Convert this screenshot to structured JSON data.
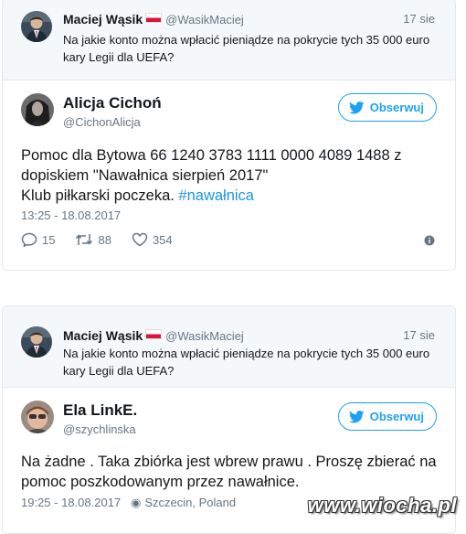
{
  "tweets": [
    {
      "reply": {
        "name": "Maciej Wąsik",
        "handle": "@WasikMaciej",
        "date": "17 sie",
        "text": "Na jakie konto można wpłacić pieniądze na pokrycie tych 35 000 euro kary Legii dla UEFA?"
      },
      "author": {
        "name": "Alicja Cichoń",
        "handle": "@CichonAlicja"
      },
      "follow_label": "Obserwuj",
      "lines": [
        "Pomoc dla Bytowa 66 1240 3783 1111 0000 4089 1488 z",
        "dopiskiem \"Nawałnica sierpień 2017\""
      ],
      "line3_text": "Klub piłkarski poczeka. ",
      "hashtag": "#nawałnica",
      "timestamp": "13:25 - 18.08.2017",
      "replies": "15",
      "retweets": "88",
      "likes": "354"
    },
    {
      "reply": {
        "name": "Maciej Wąsik",
        "handle": "@WasikMaciej",
        "date": "17 sie",
        "text": "Na jakie konto można wpłacić pieniądze na pokrycie tych 35 000 euro kary Legii dla UEFA?"
      },
      "author": {
        "name": "Ela LinkE.",
        "handle": "@szychlinska"
      },
      "follow_label": "Obserwuj",
      "lines": [
        "Na żadne . Taka zbiórka jest wbrew prawu . Proszę zbierać na",
        "pomoc poszkodowanym przez nawałnice."
      ],
      "timestamp": "19:25 - 18.08.2017",
      "location": "Szczecin, Poland"
    }
  ],
  "watermark": "www.wiocha.pl",
  "colors": {
    "accent": "#1da1f2",
    "muted": "#657786",
    "reply_bg": "#f5f8fa",
    "border": "#e1e8ed"
  }
}
